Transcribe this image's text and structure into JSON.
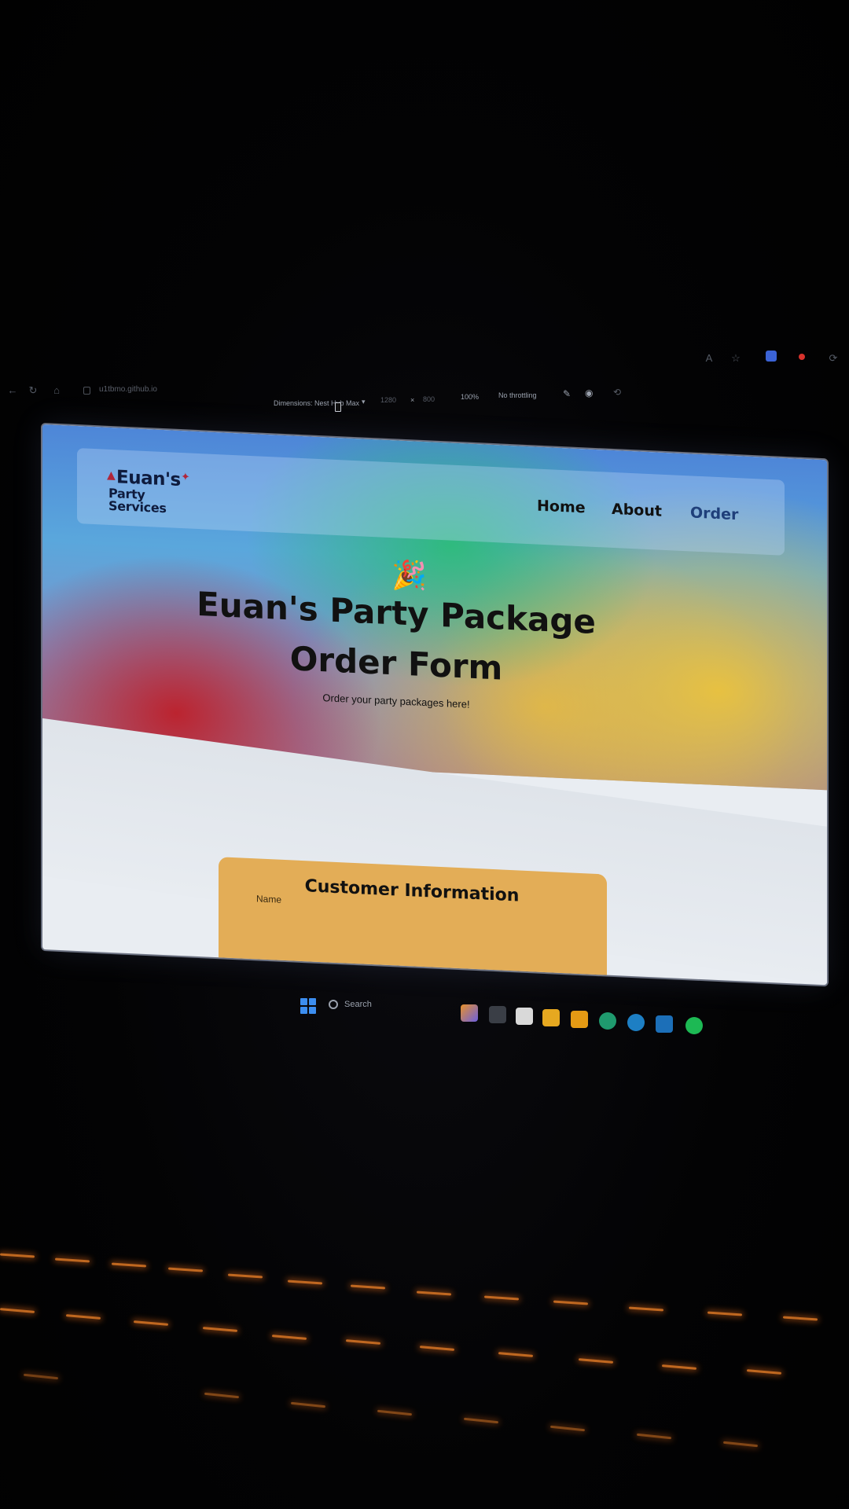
{
  "browser": {
    "url": "u1tbmo.github.io",
    "devtools": {
      "dimensions_label": "Dimensions: Nest Hub Max",
      "width": "1280",
      "times": "×",
      "height": "800",
      "zoom": "100%",
      "throttling": "No throttling"
    }
  },
  "site": {
    "logo": {
      "line1": "Euan's",
      "line2": "Party Services"
    },
    "nav": [
      {
        "label": "Home"
      },
      {
        "label": "About"
      },
      {
        "label": "Order"
      }
    ],
    "hero": {
      "icon": "party-popper-icon",
      "title_line1": "Euan's Party Package",
      "title_line2": "Order Form",
      "subtitle": "Order your party packages here!"
    },
    "form": {
      "section_title": "Customer Information",
      "name_label": "Name"
    },
    "colors": {
      "form_card": "#e3ad57",
      "active_nav": "#1f3f7a"
    }
  },
  "taskbar": {
    "search_label": "Search",
    "apps": [
      "copilot-icon",
      "terminal-icon",
      "store-icon",
      "folder-icon",
      "folder-icon",
      "edge-icon",
      "edge-dev-icon",
      "vscode-icon",
      "spotify-icon"
    ]
  }
}
